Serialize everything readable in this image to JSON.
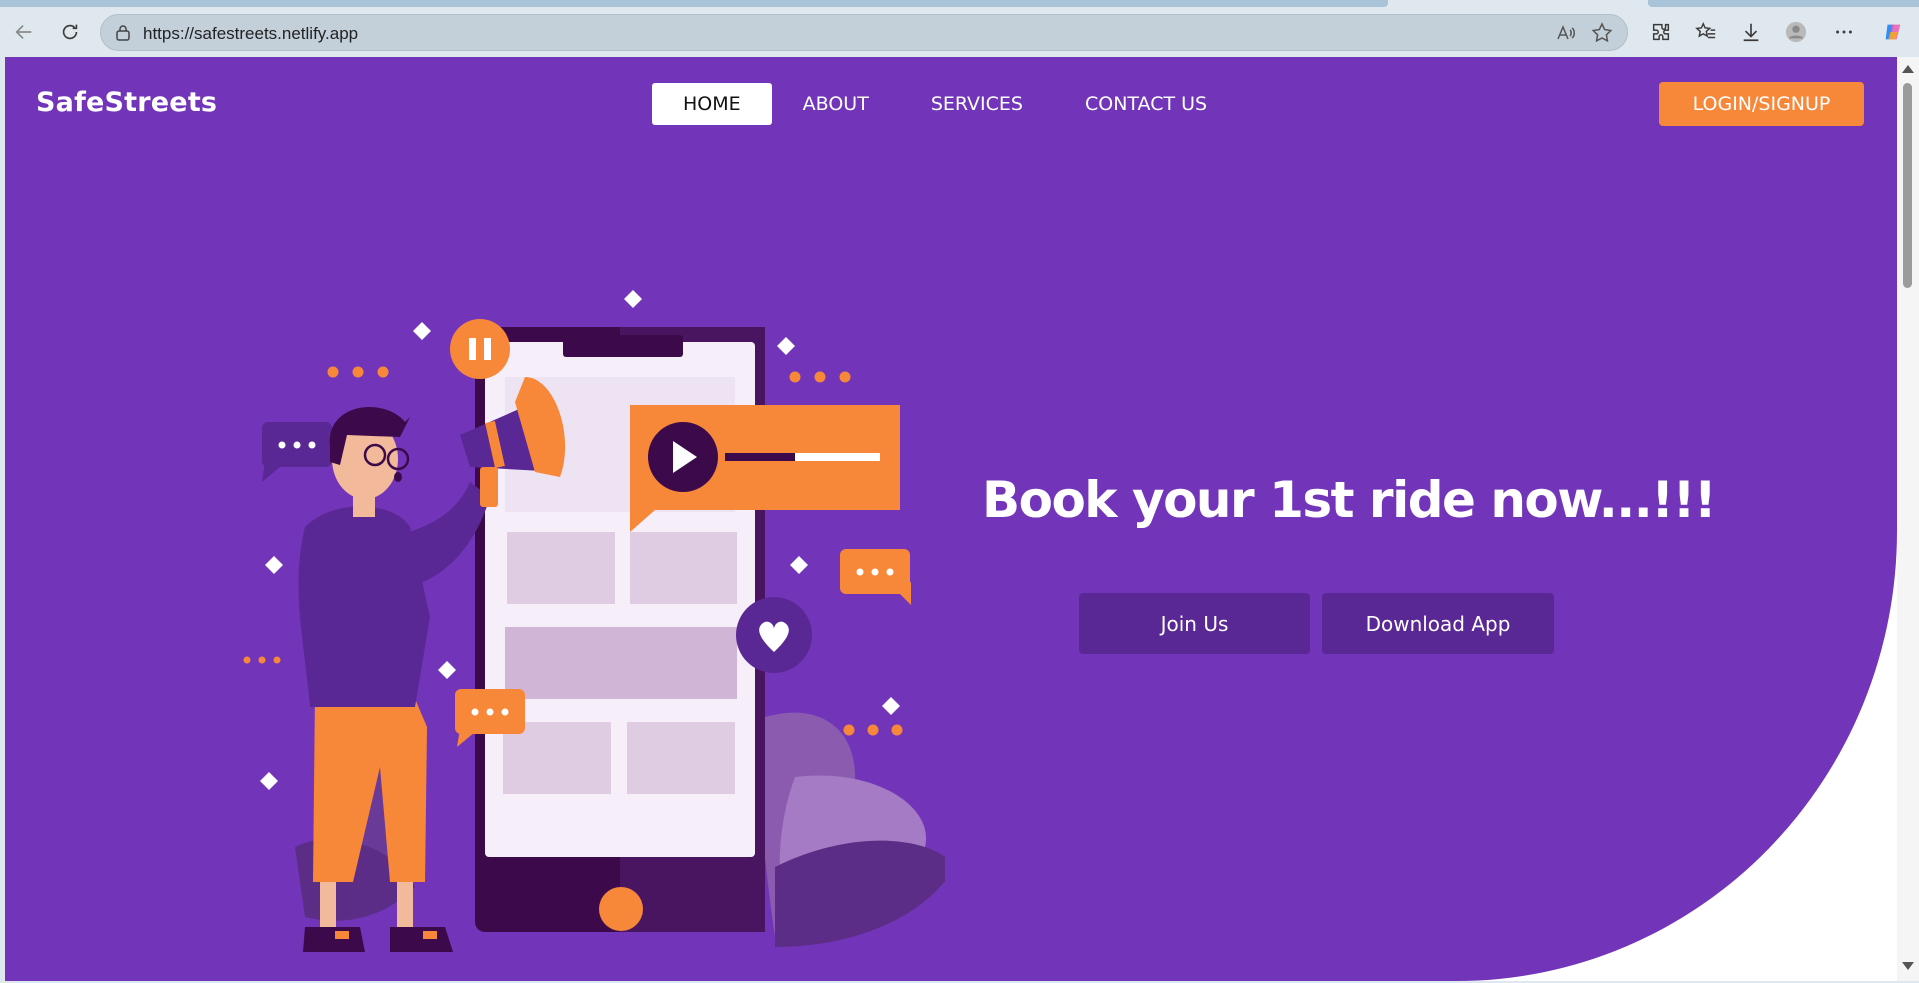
{
  "browser": {
    "url": "https://safestreets.netlify.app",
    "icons": [
      "back-arrow-icon",
      "reload-icon",
      "site-info-icon",
      "read-aloud-icon",
      "favorite-star-icon",
      "extensions-icon",
      "favorites-icon",
      "downloads-icon",
      "profile-icon",
      "more-icon",
      "copilot-icon"
    ]
  },
  "site": {
    "logo": "SafeStreets",
    "nav": [
      {
        "label": "HOME",
        "active": true
      },
      {
        "label": "ABOUT",
        "active": false
      },
      {
        "label": "SERVICES",
        "active": false
      },
      {
        "label": "CONTACT US",
        "active": false
      }
    ],
    "login_label": "LOGIN/SIGNUP",
    "headline": "Book your 1st ride now...!!!",
    "join_label": "Join Us",
    "download_label": "Download App"
  },
  "colors": {
    "hero_bg": "#7235b9",
    "accent_orange": "#f7883a",
    "button_dark": "#5a2894"
  }
}
